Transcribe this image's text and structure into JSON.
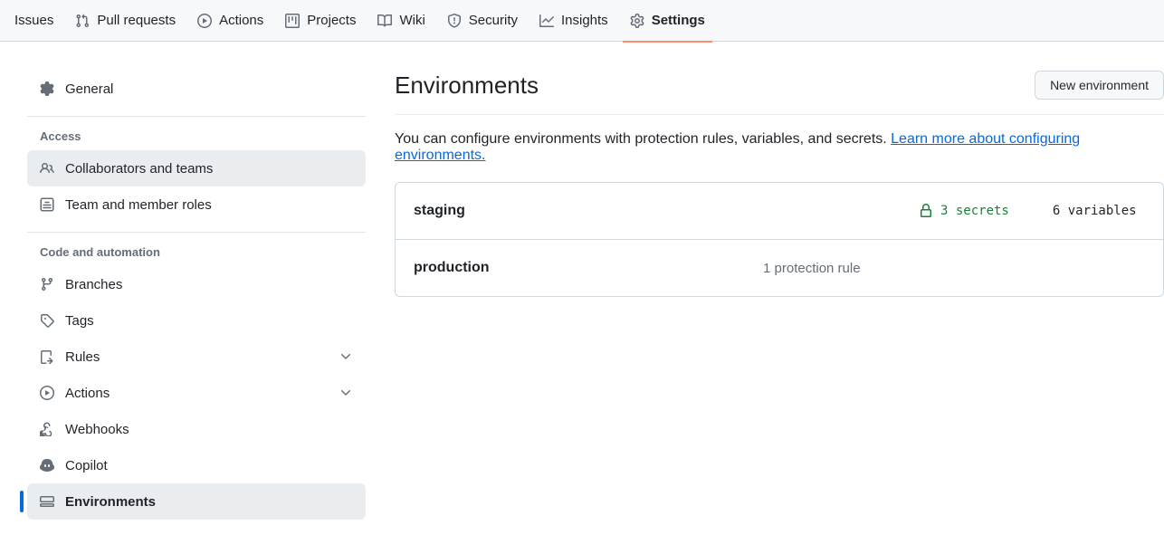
{
  "nav": {
    "items": [
      {
        "label": "Issues"
      },
      {
        "label": "Pull requests"
      },
      {
        "label": "Actions"
      },
      {
        "label": "Projects"
      },
      {
        "label": "Wiki"
      },
      {
        "label": "Security"
      },
      {
        "label": "Insights"
      },
      {
        "label": "Settings"
      }
    ]
  },
  "sidebar": {
    "general": "General",
    "sections": {
      "access": {
        "title": "Access",
        "items": [
          "Collaborators and teams",
          "Team and member roles"
        ]
      },
      "code": {
        "title": "Code and automation",
        "items": [
          "Branches",
          "Tags",
          "Rules",
          "Actions",
          "Webhooks",
          "Copilot",
          "Environments"
        ]
      }
    }
  },
  "page": {
    "title": "Environments",
    "new_button": "New environment",
    "description_prefix": "You can configure environments with protection rules, variables, and secrets. ",
    "description_link": "Learn more about configuring environments."
  },
  "environments": [
    {
      "name": "staging",
      "secrets": "3 secrets",
      "variables": "6 variables"
    },
    {
      "name": "production",
      "protection": "1 protection rule"
    }
  ]
}
